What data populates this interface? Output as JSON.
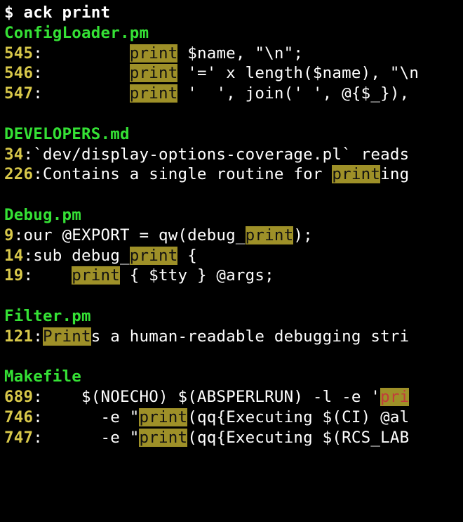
{
  "prompt": "$ ",
  "command": "ack print",
  "files": [
    {
      "name": "ConfigLoader.pm",
      "lines": [
        {
          "n": "545",
          "segs": [
            {
              "t": ":         ",
              "c": "plain"
            },
            {
              "t": "print",
              "c": "hl"
            },
            {
              "t": " $name, \"\\n\";",
              "c": "plain"
            }
          ]
        },
        {
          "n": "546",
          "segs": [
            {
              "t": ":         ",
              "c": "plain"
            },
            {
              "t": "print",
              "c": "hl"
            },
            {
              "t": " '=' x length($name), \"\\n",
              "c": "plain"
            }
          ]
        },
        {
          "n": "547",
          "segs": [
            {
              "t": ":         ",
              "c": "plain"
            },
            {
              "t": "print",
              "c": "hl"
            },
            {
              "t": " '  ', join(' ', @{$_}),",
              "c": "plain"
            }
          ]
        }
      ]
    },
    {
      "name": "DEVELOPERS.md",
      "lines": [
        {
          "n": "34",
          "segs": [
            {
              "t": ":`dev/display-options-coverage.pl` reads",
              "c": "plain"
            }
          ]
        },
        {
          "n": "226",
          "segs": [
            {
              "t": ":Contains a single routine for ",
              "c": "plain"
            },
            {
              "t": "print",
              "c": "hl"
            },
            {
              "t": "ing",
              "c": "plain"
            }
          ]
        }
      ]
    },
    {
      "name": "Debug.pm",
      "lines": [
        {
          "n": "9",
          "segs": [
            {
              "t": ":our @EXPORT = qw(debug_",
              "c": "plain"
            },
            {
              "t": "print",
              "c": "hl"
            },
            {
              "t": ");",
              "c": "plain"
            }
          ]
        },
        {
          "n": "14",
          "segs": [
            {
              "t": ":sub debug_",
              "c": "plain"
            },
            {
              "t": "print",
              "c": "hl"
            },
            {
              "t": " {",
              "c": "plain"
            }
          ]
        },
        {
          "n": "19",
          "segs": [
            {
              "t": ":    ",
              "c": "plain"
            },
            {
              "t": "print",
              "c": "hl"
            },
            {
              "t": " { $tty } @args;",
              "c": "plain"
            }
          ]
        }
      ]
    },
    {
      "name": "Filter.pm",
      "lines": [
        {
          "n": "121",
          "segs": [
            {
              "t": ":",
              "c": "plain"
            },
            {
              "t": "Print",
              "c": "hl"
            },
            {
              "t": "s a human-readable debugging stri",
              "c": "plain"
            }
          ]
        }
      ]
    },
    {
      "name": "Makefile",
      "lines": [
        {
          "n": "689",
          "segs": [
            {
              "t": ":    $(NOECHO) $(ABSPERLRUN) -l -e '",
              "c": "plain"
            },
            {
              "t": "pri",
              "c": "hlstr"
            }
          ]
        },
        {
          "n": "746",
          "segs": [
            {
              "t": ":      -e \"",
              "c": "plain"
            },
            {
              "t": "print",
              "c": "hl"
            },
            {
              "t": "(qq{Executing $(CI) @al",
              "c": "plain"
            }
          ]
        },
        {
          "n": "747",
          "segs": [
            {
              "t": ":      -e \"",
              "c": "plain"
            },
            {
              "t": "print",
              "c": "hl"
            },
            {
              "t": "(qq{Executing $(RCS_LAB",
              "c": "plain"
            }
          ]
        }
      ]
    }
  ]
}
